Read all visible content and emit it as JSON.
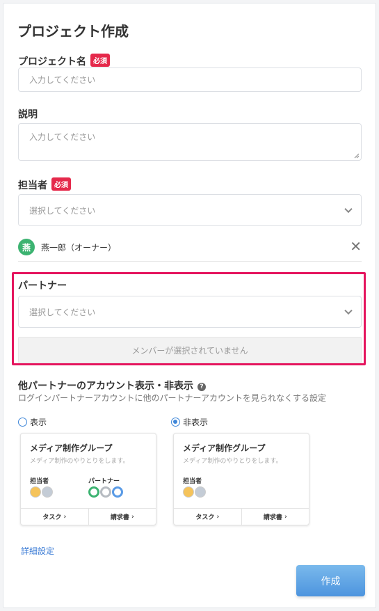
{
  "page": {
    "title": "プロジェクト作成"
  },
  "required_badge": "必須",
  "project_name": {
    "label": "プロジェクト名",
    "placeholder": "入力してください"
  },
  "description": {
    "label": "説明",
    "placeholder": "入力してください"
  },
  "assignee": {
    "label": "担当者",
    "placeholder": "選択してください",
    "selected": {
      "avatar_text": "燕",
      "name": "燕一郎（オーナー）",
      "avatar_color": "#3cb371"
    }
  },
  "partner": {
    "label": "パートナー",
    "placeholder": "選択してください",
    "empty_text": "メンバーが選択されていません"
  },
  "visibility": {
    "title": "他パートナーのアカウント表示・非表示",
    "help_icon": "?",
    "description": "ログインパートナーアカウントに他のパートナーアカウントを見られなくする設定",
    "selected": "hide",
    "options": [
      {
        "label": "表示",
        "value": "show"
      },
      {
        "label": "非表示",
        "value": "hide"
      }
    ]
  },
  "preview_card": {
    "title": "メディア制作グループ",
    "description": "メディア制作のやりとりをします。",
    "assignee_label": "担当者",
    "partner_label": "パートナー",
    "task_label": "タスク",
    "invoice_label": "請求書"
  },
  "advanced_link": "詳細設定",
  "submit_label": "作成",
  "colors": {
    "accent": "#3f87d9",
    "required": "#e5294b",
    "highlight": "#e5155e",
    "link": "#3a7bd5"
  }
}
